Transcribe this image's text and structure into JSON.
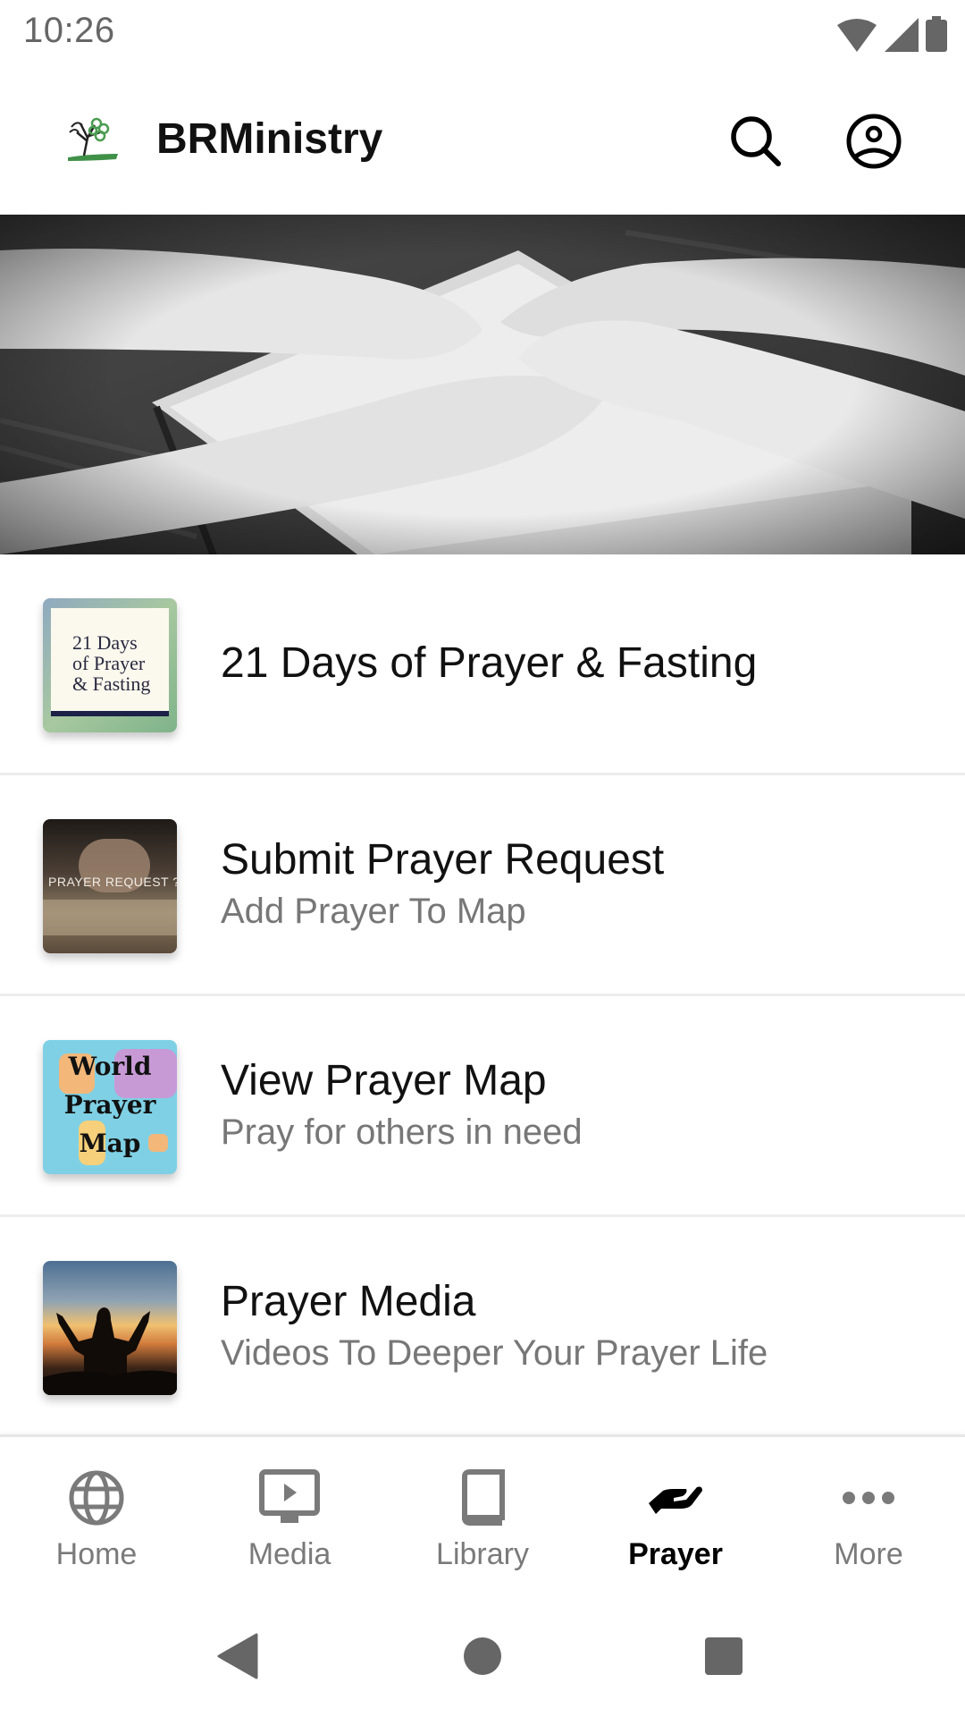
{
  "status_bar": {
    "time": "10:26",
    "icons": [
      "wifi-icon",
      "cellular-signal-icon",
      "battery-icon"
    ]
  },
  "toolbar": {
    "logo": "tree-logo",
    "title": "BRMinistry",
    "actions": [
      "search-icon",
      "account-circle-icon"
    ]
  },
  "hero": {
    "description": "Black and white photo of two pairs of hands held together over an open Bible"
  },
  "list": {
    "items": [
      {
        "title": "21 Days of Prayer & Fasting",
        "subtitle": "",
        "thumb_lines": [
          "21 Days",
          "of Prayer",
          "& Fasting"
        ]
      },
      {
        "title": "Submit Prayer Request",
        "subtitle": "Add Prayer To Map",
        "thumb_text": "PRAYER REQUEST ?"
      },
      {
        "title": "View Prayer Map",
        "subtitle": "Pray for others in need",
        "thumb_lines": [
          "World",
          "Prayer",
          "Map"
        ]
      },
      {
        "title": "Prayer Media",
        "subtitle": "Videos To Deeper Your Prayer Life"
      }
    ]
  },
  "bottom_nav": {
    "active": "Prayer",
    "items": [
      {
        "label": "Home",
        "icon": "globe-icon"
      },
      {
        "label": "Media",
        "icon": "tv-play-icon"
      },
      {
        "label": "Library",
        "icon": "book-icon"
      },
      {
        "label": "Prayer",
        "icon": "praying-hand-icon"
      },
      {
        "label": "More",
        "icon": "more-horizontal-icon"
      }
    ]
  },
  "system_nav": [
    "back-button",
    "home-button",
    "recents-button"
  ],
  "colors": {
    "active_nav": "#000000",
    "inactive_nav": "#7a7a7a",
    "subtitle": "#777777",
    "status_icons": "#666666"
  }
}
